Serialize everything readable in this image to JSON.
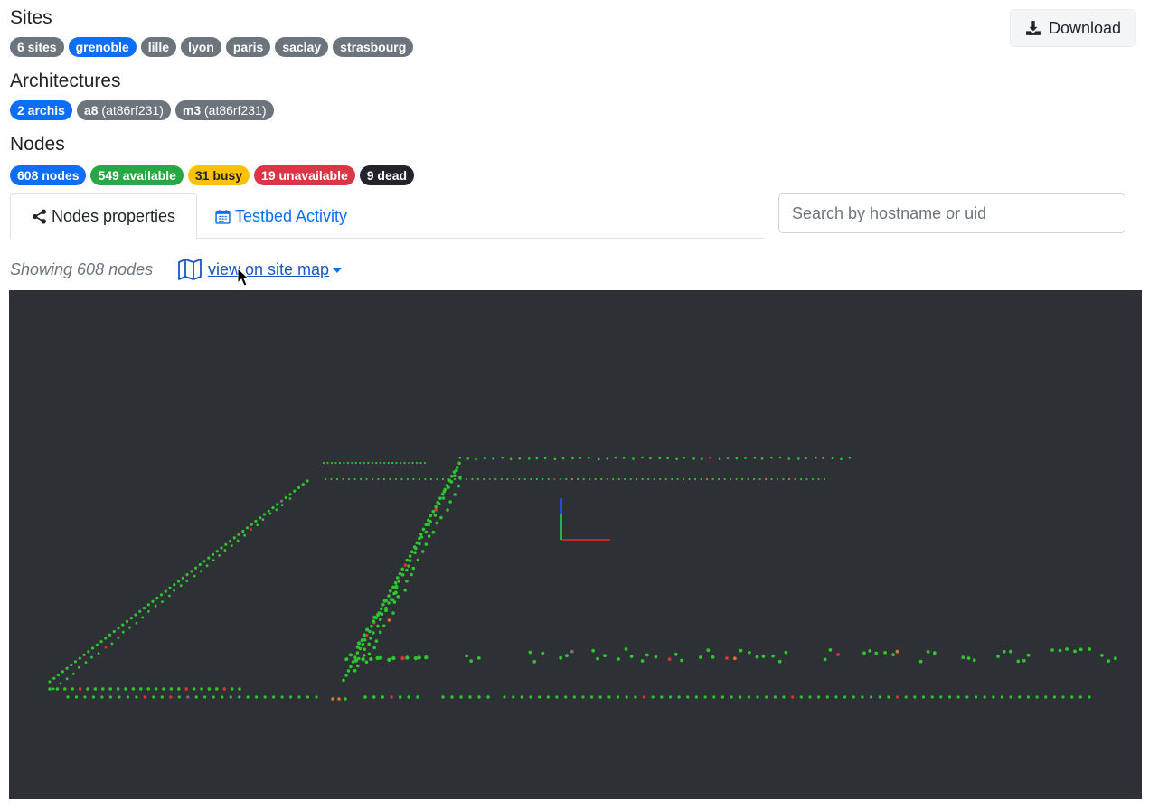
{
  "sites": {
    "title": "Sites",
    "badges": [
      {
        "label": "6 sites",
        "style": "secondary"
      },
      {
        "label": "grenoble",
        "style": "primary"
      },
      {
        "label": "lille",
        "style": "secondary"
      },
      {
        "label": "lyon",
        "style": "secondary"
      },
      {
        "label": "paris",
        "style": "secondary"
      },
      {
        "label": "saclay",
        "style": "secondary"
      },
      {
        "label": "strasbourg",
        "style": "secondary"
      }
    ]
  },
  "architectures": {
    "title": "Architectures",
    "badges": [
      {
        "label": "2 archis",
        "style": "primary"
      },
      {
        "name": "a8",
        "detail": "(at86rf231)",
        "style": "secondary"
      },
      {
        "name": "m3",
        "detail": "(at86rf231)",
        "style": "secondary"
      }
    ]
  },
  "nodes": {
    "title": "Nodes",
    "badges": [
      {
        "label": "608 nodes",
        "style": "primary"
      },
      {
        "label": "549 available",
        "style": "success"
      },
      {
        "label": "31 busy",
        "style": "warning"
      },
      {
        "label": "19 unavailable",
        "style": "danger"
      },
      {
        "label": "9 dead",
        "style": "dark"
      }
    ]
  },
  "toolbar": {
    "download_label": "Download"
  },
  "tabs": [
    {
      "label": "Nodes properties",
      "icon": "share-icon",
      "active": true
    },
    {
      "label": "Testbed Activity",
      "icon": "calendar-icon",
      "active": false
    }
  ],
  "search": {
    "placeholder": "Search by hostname or uid",
    "value": ""
  },
  "listing": {
    "showing_text": "Showing 608 nodes",
    "map_link_label": "view on site map",
    "map_icon": "map-icon"
  },
  "colors": {
    "available": "#2ec52e",
    "busy": "#e0742a",
    "unavailable": "#d93434",
    "dead": "#7a6f7a",
    "viz_background": "#2d3034"
  }
}
